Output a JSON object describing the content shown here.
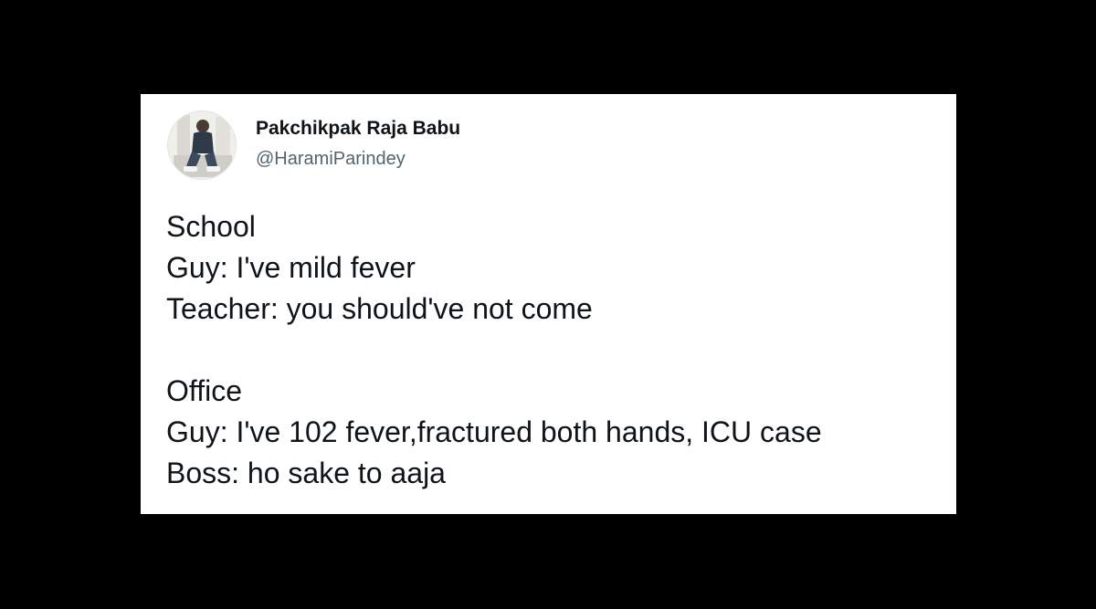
{
  "user": {
    "display_name": "Pakchikpak Raja Babu",
    "handle": "@HaramiParindey",
    "avatar_icon": "user-photo-avatar"
  },
  "tweet": {
    "lines": [
      "School",
      "Guy: I've mild fever",
      "Teacher: you should've not come",
      "",
      "Office",
      "Guy: I've 102 fever,fractured both hands, ICU case",
      "Boss: ho sake to aaja"
    ]
  },
  "colors": {
    "background": "#000000",
    "card": "#ffffff",
    "text": "#0f1419",
    "secondary_text": "#536471"
  }
}
